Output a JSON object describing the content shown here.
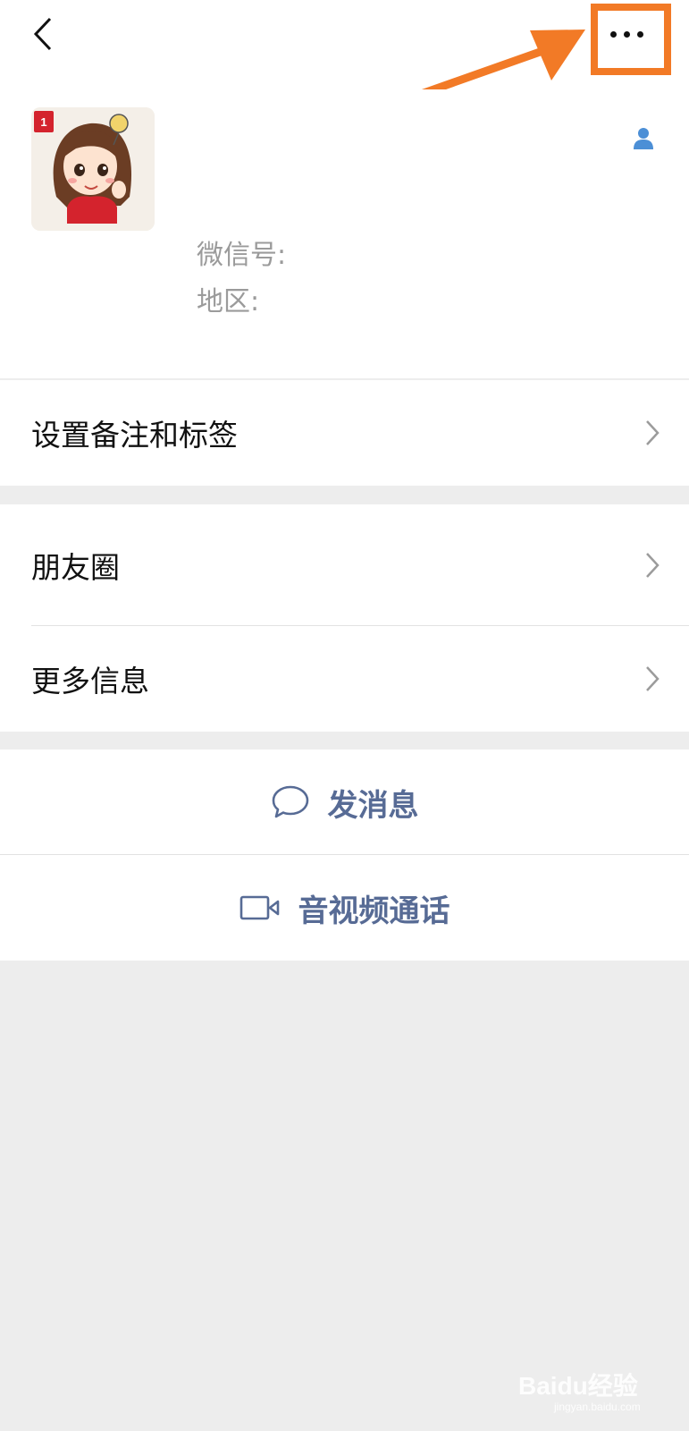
{
  "header": {
    "back_icon": "chevron-left-icon",
    "more_icon": "more-dots-icon"
  },
  "profile": {
    "badge": "1",
    "wechat_id_label": "微信号:",
    "region_label": "地区:",
    "contact_icon": "person-icon"
  },
  "menu": {
    "items": [
      {
        "label": "设置备注和标签"
      },
      {
        "label": "朋友圈"
      },
      {
        "label": "更多信息"
      }
    ]
  },
  "actions": {
    "message_label": "发消息",
    "call_label": "音视频通话"
  },
  "watermark": {
    "brand": "Baidu经验",
    "url": "jingyan.baidu.com"
  },
  "colors": {
    "accent": "#576b95",
    "highlight": "#f27a26",
    "background": "#ededed"
  }
}
